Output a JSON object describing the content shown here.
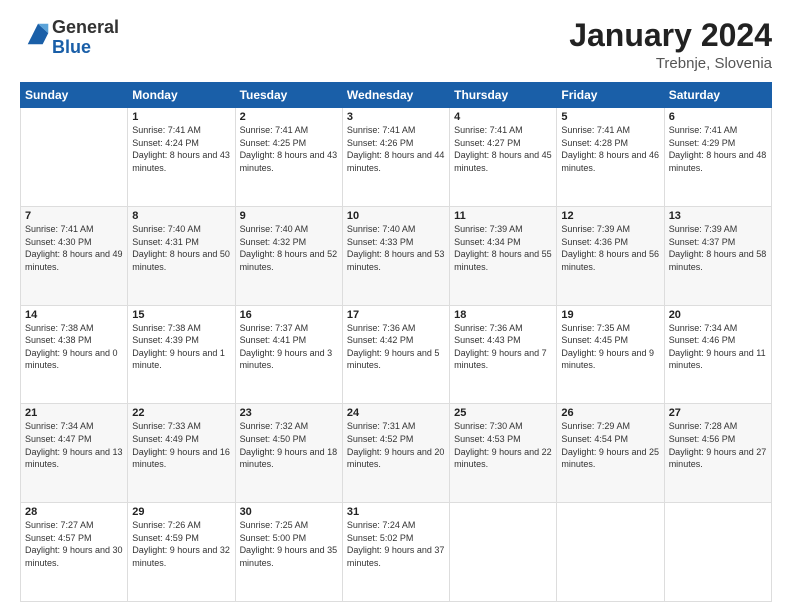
{
  "header": {
    "logo_general": "General",
    "logo_blue": "Blue",
    "month_title": "January 2024",
    "location": "Trebnje, Slovenia"
  },
  "days_of_week": [
    "Sunday",
    "Monday",
    "Tuesday",
    "Wednesday",
    "Thursday",
    "Friday",
    "Saturday"
  ],
  "weeks": [
    [
      {
        "day": "",
        "sunrise": "",
        "sunset": "",
        "daylight": ""
      },
      {
        "day": "1",
        "sunrise": "Sunrise: 7:41 AM",
        "sunset": "Sunset: 4:24 PM",
        "daylight": "Daylight: 8 hours and 43 minutes."
      },
      {
        "day": "2",
        "sunrise": "Sunrise: 7:41 AM",
        "sunset": "Sunset: 4:25 PM",
        "daylight": "Daylight: 8 hours and 43 minutes."
      },
      {
        "day": "3",
        "sunrise": "Sunrise: 7:41 AM",
        "sunset": "Sunset: 4:26 PM",
        "daylight": "Daylight: 8 hours and 44 minutes."
      },
      {
        "day": "4",
        "sunrise": "Sunrise: 7:41 AM",
        "sunset": "Sunset: 4:27 PM",
        "daylight": "Daylight: 8 hours and 45 minutes."
      },
      {
        "day": "5",
        "sunrise": "Sunrise: 7:41 AM",
        "sunset": "Sunset: 4:28 PM",
        "daylight": "Daylight: 8 hours and 46 minutes."
      },
      {
        "day": "6",
        "sunrise": "Sunrise: 7:41 AM",
        "sunset": "Sunset: 4:29 PM",
        "daylight": "Daylight: 8 hours and 48 minutes."
      }
    ],
    [
      {
        "day": "7",
        "sunrise": "Sunrise: 7:41 AM",
        "sunset": "Sunset: 4:30 PM",
        "daylight": "Daylight: 8 hours and 49 minutes."
      },
      {
        "day": "8",
        "sunrise": "Sunrise: 7:40 AM",
        "sunset": "Sunset: 4:31 PM",
        "daylight": "Daylight: 8 hours and 50 minutes."
      },
      {
        "day": "9",
        "sunrise": "Sunrise: 7:40 AM",
        "sunset": "Sunset: 4:32 PM",
        "daylight": "Daylight: 8 hours and 52 minutes."
      },
      {
        "day": "10",
        "sunrise": "Sunrise: 7:40 AM",
        "sunset": "Sunset: 4:33 PM",
        "daylight": "Daylight: 8 hours and 53 minutes."
      },
      {
        "day": "11",
        "sunrise": "Sunrise: 7:39 AM",
        "sunset": "Sunset: 4:34 PM",
        "daylight": "Daylight: 8 hours and 55 minutes."
      },
      {
        "day": "12",
        "sunrise": "Sunrise: 7:39 AM",
        "sunset": "Sunset: 4:36 PM",
        "daylight": "Daylight: 8 hours and 56 minutes."
      },
      {
        "day": "13",
        "sunrise": "Sunrise: 7:39 AM",
        "sunset": "Sunset: 4:37 PM",
        "daylight": "Daylight: 8 hours and 58 minutes."
      }
    ],
    [
      {
        "day": "14",
        "sunrise": "Sunrise: 7:38 AM",
        "sunset": "Sunset: 4:38 PM",
        "daylight": "Daylight: 9 hours and 0 minutes."
      },
      {
        "day": "15",
        "sunrise": "Sunrise: 7:38 AM",
        "sunset": "Sunset: 4:39 PM",
        "daylight": "Daylight: 9 hours and 1 minute."
      },
      {
        "day": "16",
        "sunrise": "Sunrise: 7:37 AM",
        "sunset": "Sunset: 4:41 PM",
        "daylight": "Daylight: 9 hours and 3 minutes."
      },
      {
        "day": "17",
        "sunrise": "Sunrise: 7:36 AM",
        "sunset": "Sunset: 4:42 PM",
        "daylight": "Daylight: 9 hours and 5 minutes."
      },
      {
        "day": "18",
        "sunrise": "Sunrise: 7:36 AM",
        "sunset": "Sunset: 4:43 PM",
        "daylight": "Daylight: 9 hours and 7 minutes."
      },
      {
        "day": "19",
        "sunrise": "Sunrise: 7:35 AM",
        "sunset": "Sunset: 4:45 PM",
        "daylight": "Daylight: 9 hours and 9 minutes."
      },
      {
        "day": "20",
        "sunrise": "Sunrise: 7:34 AM",
        "sunset": "Sunset: 4:46 PM",
        "daylight": "Daylight: 9 hours and 11 minutes."
      }
    ],
    [
      {
        "day": "21",
        "sunrise": "Sunrise: 7:34 AM",
        "sunset": "Sunset: 4:47 PM",
        "daylight": "Daylight: 9 hours and 13 minutes."
      },
      {
        "day": "22",
        "sunrise": "Sunrise: 7:33 AM",
        "sunset": "Sunset: 4:49 PM",
        "daylight": "Daylight: 9 hours and 16 minutes."
      },
      {
        "day": "23",
        "sunrise": "Sunrise: 7:32 AM",
        "sunset": "Sunset: 4:50 PM",
        "daylight": "Daylight: 9 hours and 18 minutes."
      },
      {
        "day": "24",
        "sunrise": "Sunrise: 7:31 AM",
        "sunset": "Sunset: 4:52 PM",
        "daylight": "Daylight: 9 hours and 20 minutes."
      },
      {
        "day": "25",
        "sunrise": "Sunrise: 7:30 AM",
        "sunset": "Sunset: 4:53 PM",
        "daylight": "Daylight: 9 hours and 22 minutes."
      },
      {
        "day": "26",
        "sunrise": "Sunrise: 7:29 AM",
        "sunset": "Sunset: 4:54 PM",
        "daylight": "Daylight: 9 hours and 25 minutes."
      },
      {
        "day": "27",
        "sunrise": "Sunrise: 7:28 AM",
        "sunset": "Sunset: 4:56 PM",
        "daylight": "Daylight: 9 hours and 27 minutes."
      }
    ],
    [
      {
        "day": "28",
        "sunrise": "Sunrise: 7:27 AM",
        "sunset": "Sunset: 4:57 PM",
        "daylight": "Daylight: 9 hours and 30 minutes."
      },
      {
        "day": "29",
        "sunrise": "Sunrise: 7:26 AM",
        "sunset": "Sunset: 4:59 PM",
        "daylight": "Daylight: 9 hours and 32 minutes."
      },
      {
        "day": "30",
        "sunrise": "Sunrise: 7:25 AM",
        "sunset": "Sunset: 5:00 PM",
        "daylight": "Daylight: 9 hours and 35 minutes."
      },
      {
        "day": "31",
        "sunrise": "Sunrise: 7:24 AM",
        "sunset": "Sunset: 5:02 PM",
        "daylight": "Daylight: 9 hours and 37 minutes."
      },
      {
        "day": "",
        "sunrise": "",
        "sunset": "",
        "daylight": ""
      },
      {
        "day": "",
        "sunrise": "",
        "sunset": "",
        "daylight": ""
      },
      {
        "day": "",
        "sunrise": "",
        "sunset": "",
        "daylight": ""
      }
    ]
  ]
}
